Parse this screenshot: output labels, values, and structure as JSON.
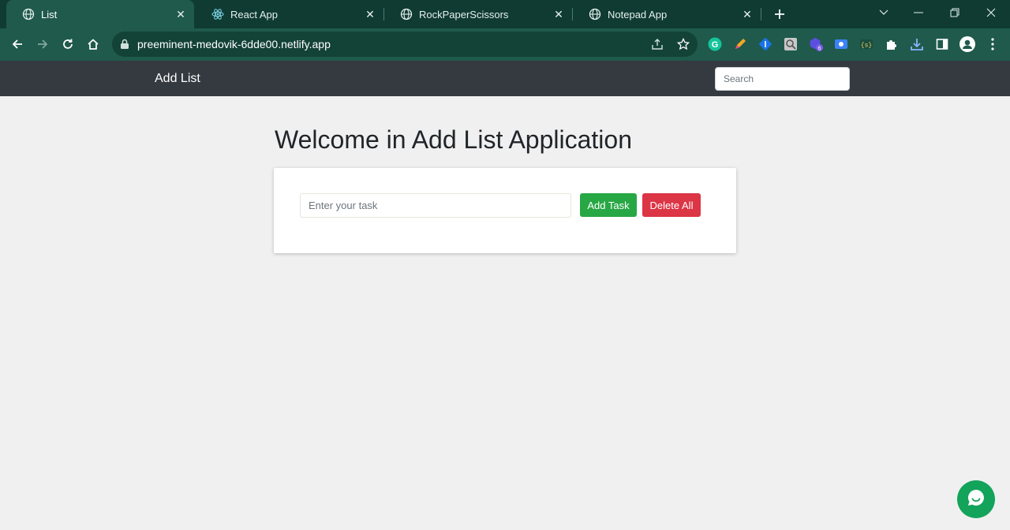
{
  "browser": {
    "tabs": [
      {
        "title": "List",
        "active": true
      },
      {
        "title": "React App",
        "active": false
      },
      {
        "title": "RockPaperScissors",
        "active": false
      },
      {
        "title": "Notepad App",
        "active": false
      }
    ],
    "url": "preeminent-medovik-6dde00.netlify.app",
    "extension_badge": "6",
    "colors": {
      "tabbar": "#0f3b33",
      "toolbar": "#1f5a4c"
    }
  },
  "navbar": {
    "brand": "Add List",
    "search_placeholder": "Search"
  },
  "main": {
    "heading": "Welcome in Add List Application",
    "task_placeholder": "Enter your task",
    "add_label": "Add Task",
    "delete_label": "Delete All"
  },
  "colors": {
    "navbar": "#343a40",
    "add_button": "#28a745",
    "delete_button": "#dc3545",
    "chat": "#13a35a"
  },
  "icons": [
    "globe-icon",
    "react-icon",
    "close-icon",
    "plus-icon",
    "back-icon",
    "forward-icon",
    "reload-icon",
    "home-icon",
    "lock-icon",
    "share-icon",
    "star-icon",
    "puzzle-icon",
    "download-icon",
    "sidepanel-icon",
    "profile-icon",
    "menu-icon",
    "chat-icon"
  ]
}
